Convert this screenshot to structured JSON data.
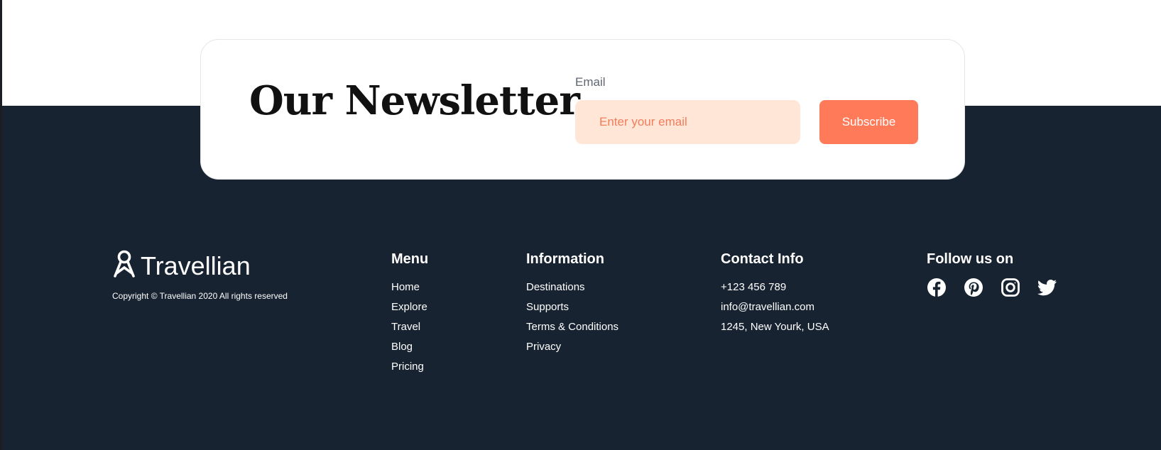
{
  "newsletter": {
    "title": "Our Newsletter",
    "email_label": "Email",
    "email_placeholder": "Enter your email",
    "subscribe_label": "Subscribe"
  },
  "brand": {
    "name": "Travellian",
    "copyright": "Copyright © Travellian 2020 All rights reserved",
    "icon": "location-pin-logo-icon"
  },
  "menu": {
    "heading": "Menu",
    "items": [
      "Home",
      "Explore",
      "Travel",
      "Blog",
      "Pricing"
    ]
  },
  "information": {
    "heading": "Information",
    "items": [
      "Destinations",
      "Supports",
      "Terms & Conditions",
      "Privacy"
    ]
  },
  "contact": {
    "heading": "Contact Info",
    "items": [
      "+123 456 789",
      "info@travellian.com",
      "1245, New Yourk, USA"
    ]
  },
  "follow": {
    "heading": "Follow us on",
    "icons": [
      "facebook-icon",
      "pinterest-icon",
      "instagram-icon",
      "twitter-icon"
    ]
  },
  "colors": {
    "footer_bg": "#182331",
    "accent": "#ff7a59",
    "input_bg": "#ffe6d6"
  }
}
